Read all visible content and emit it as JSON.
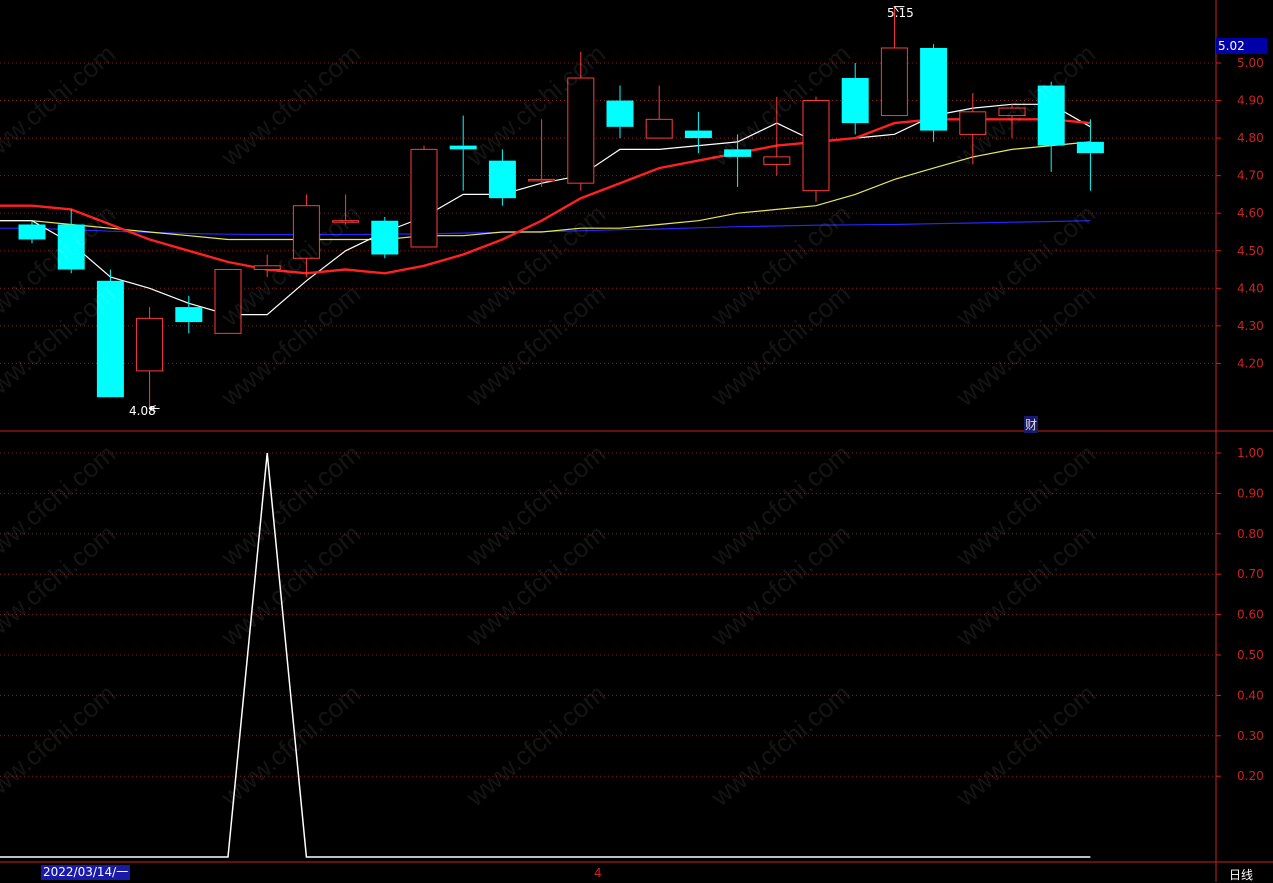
{
  "current_price": "5.02",
  "high_label": "5.15",
  "low_label": "4.08",
  "date_label": "2022/03/14/一",
  "period_label": "日线",
  "finance_icon": "财",
  "x_mid_label": "4",
  "watermark": "www.cfchi.com",
  "colors": {
    "up": "#ff3b3b",
    "down": "#00ffff",
    "ma5": "#ffffff",
    "ma10": "#ff2020",
    "ma20": "#e8e85a",
    "ma60": "#2626ff",
    "grid": "#8a1a1a",
    "axis": "#cc2222"
  },
  "chart_data": [
    {
      "type": "candlestick",
      "ylim": [
        4.08,
        5.1
      ],
      "y_ticks": [
        "5.00",
        "4.90",
        "4.80",
        "4.70",
        "4.60",
        "4.50",
        "4.40",
        "4.30",
        "4.20"
      ],
      "candles": [
        {
          "o": 4.57,
          "c": 4.53,
          "h": 4.58,
          "l": 4.52
        },
        {
          "o": 4.57,
          "c": 4.45,
          "h": 4.61,
          "l": 4.44
        },
        {
          "o": 4.42,
          "c": 4.11,
          "h": 4.45,
          "l": 4.11
        },
        {
          "o": 4.18,
          "c": 4.32,
          "h": 4.35,
          "l": 4.08
        },
        {
          "o": 4.35,
          "c": 4.31,
          "h": 4.38,
          "l": 4.28
        },
        {
          "o": 4.28,
          "c": 4.45,
          "h": 4.45,
          "l": 4.28
        },
        {
          "o": 4.45,
          "c": 4.46,
          "h": 4.49,
          "l": 4.43
        },
        {
          "o": 4.48,
          "c": 4.62,
          "h": 4.65,
          "l": 4.43
        },
        {
          "o": 4.58,
          "c": 4.58,
          "h": 4.65,
          "l": 4.57
        },
        {
          "o": 4.58,
          "c": 4.49,
          "h": 4.59,
          "l": 4.48
        },
        {
          "o": 4.51,
          "c": 4.77,
          "h": 4.78,
          "l": 4.51
        },
        {
          "o": 4.78,
          "c": 4.77,
          "h": 4.86,
          "l": 4.66
        },
        {
          "o": 4.74,
          "c": 4.64,
          "h": 4.77,
          "l": 4.62
        },
        {
          "o": 4.69,
          "c": 4.69,
          "h": 4.85,
          "l": 4.67
        },
        {
          "o": 4.68,
          "c": 4.96,
          "h": 5.03,
          "l": 4.66
        },
        {
          "o": 4.9,
          "c": 4.83,
          "h": 4.94,
          "l": 4.8
        },
        {
          "o": 4.8,
          "c": 4.85,
          "h": 4.94,
          "l": 4.8
        },
        {
          "o": 4.82,
          "c": 4.8,
          "h": 4.87,
          "l": 4.76
        },
        {
          "o": 4.77,
          "c": 4.75,
          "h": 4.81,
          "l": 4.67
        },
        {
          "o": 4.73,
          "c": 4.75,
          "h": 4.91,
          "l": 4.7
        },
        {
          "o": 4.66,
          "c": 4.9,
          "h": 4.91,
          "l": 4.63
        },
        {
          "o": 4.96,
          "c": 4.84,
          "h": 5.0,
          "l": 4.81
        },
        {
          "o": 4.86,
          "c": 5.04,
          "h": 5.15,
          "l": 4.86
        },
        {
          "o": 5.04,
          "c": 4.82,
          "h": 5.05,
          "l": 4.79
        },
        {
          "o": 4.81,
          "c": 4.87,
          "h": 4.92,
          "l": 4.73
        },
        {
          "o": 4.86,
          "c": 4.88,
          "h": 4.89,
          "l": 4.8
        },
        {
          "o": 4.94,
          "c": 4.78,
          "h": 4.95,
          "l": 4.71
        },
        {
          "o": 4.79,
          "c": 4.76,
          "h": 4.85,
          "l": 4.66
        }
      ],
      "ma5": [
        4.58,
        4.52,
        4.43,
        4.4,
        4.36,
        4.33,
        4.33,
        4.42,
        4.5,
        4.55,
        4.59,
        4.65,
        4.65,
        4.68,
        4.7,
        4.77,
        4.77,
        4.78,
        4.79,
        4.84,
        4.79,
        4.8,
        4.81,
        4.86,
        4.88,
        4.89,
        4.89,
        4.83
      ],
      "ma10": [
        4.62,
        4.61,
        4.57,
        4.53,
        4.5,
        4.47,
        4.45,
        4.44,
        4.45,
        4.44,
        4.46,
        4.49,
        4.53,
        4.58,
        4.64,
        4.68,
        4.72,
        4.74,
        4.76,
        4.78,
        4.79,
        4.8,
        4.84,
        4.85,
        4.85,
        4.85,
        4.85,
        4.84
      ],
      "ma20": [
        4.58,
        4.57,
        4.56,
        4.55,
        4.54,
        4.53,
        4.53,
        4.53,
        4.53,
        4.53,
        4.54,
        4.54,
        4.55,
        4.55,
        4.56,
        4.56,
        4.57,
        4.58,
        4.6,
        4.61,
        4.62,
        4.65,
        4.69,
        4.72,
        4.75,
        4.77,
        4.78,
        4.79
      ],
      "ma60": [
        4.56,
        4.556,
        4.552,
        4.549,
        4.546,
        4.544,
        4.543,
        4.543,
        4.543,
        4.544,
        4.545,
        4.547,
        4.549,
        4.551,
        4.553,
        4.556,
        4.558,
        4.561,
        4.564,
        4.566,
        4.568,
        4.569,
        4.57,
        4.572,
        4.574,
        4.576,
        4.578,
        4.58
      ]
    },
    {
      "type": "line",
      "ylim": [
        0,
        1.0
      ],
      "y_ticks": [
        "1.00",
        "0.90",
        "0.80",
        "0.70",
        "0.60",
        "0.50",
        "0.40",
        "0.30",
        "0.20"
      ],
      "values": [
        0,
        0,
        0,
        0,
        0,
        0,
        1,
        0,
        0,
        0,
        0,
        0,
        0,
        0,
        0,
        0,
        0,
        0,
        0,
        0,
        0,
        0,
        0,
        0,
        0,
        0,
        0,
        0
      ]
    }
  ]
}
